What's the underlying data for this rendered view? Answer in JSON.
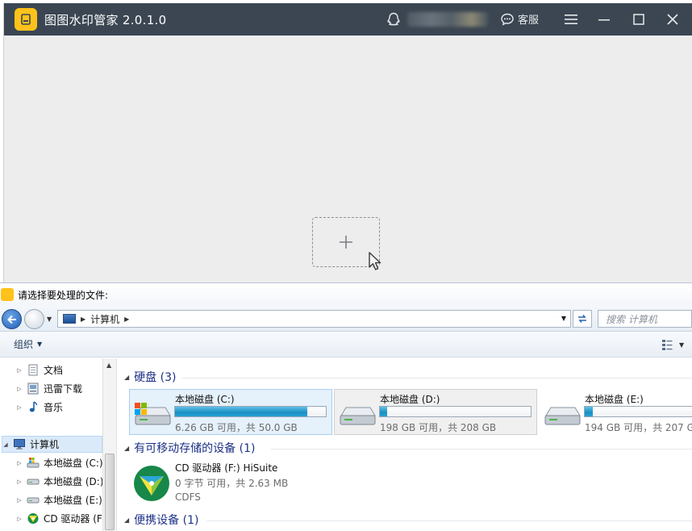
{
  "app": {
    "title": "图图水印管家  2.0.1.0",
    "service_label": "客服",
    "accent": "#ffc21a",
    "titlebar_color": "#3b4652",
    "drop_icon": "plus-icon"
  },
  "dialog": {
    "title": "请选择要处理的文件:",
    "address": {
      "path_item": "计算机"
    },
    "search_placeholder": "搜索 计算机",
    "organize_label": "组织"
  },
  "nav_tree": {
    "items": [
      {
        "label": "文档",
        "icon": "documents-icon"
      },
      {
        "label": "迅雷下载",
        "icon": "downloads-folder-icon"
      },
      {
        "label": "音乐",
        "icon": "music-icon"
      },
      {
        "label": "计算机",
        "icon": "computer-icon",
        "selected": true
      },
      {
        "label": "本地磁盘 (C:)",
        "icon": "system-drive-icon"
      },
      {
        "label": "本地磁盘 (D:)",
        "icon": "drive-icon"
      },
      {
        "label": "本地磁盘 (E:)",
        "icon": "drive-icon"
      },
      {
        "label": "CD 驱动器 (F:",
        "icon": "cd-drive-icon"
      }
    ]
  },
  "groups": {
    "hdd": "硬盘 (3)",
    "removable": "有可移动存储的设备 (1)",
    "portable": "便携设备 (1)"
  },
  "drives": [
    {
      "name": "本地磁盘 (C:)",
      "free_text": "6.26 GB 可用，共 50.0 GB",
      "used_fraction": 0.875
    },
    {
      "name": "本地磁盘 (D:)",
      "free_text": "198 GB 可用，共 208 GB",
      "used_fraction": 0.048
    },
    {
      "name": "本地磁盘 (E:)",
      "free_text": "194 GB 可用，共 207 G",
      "used_fraction": 0.063
    }
  ],
  "cd_drive": {
    "name": "CD 驱动器 (F:) HiSuite",
    "free_text": "0 字节 可用，共 2.63 MB",
    "fs": "CDFS"
  }
}
